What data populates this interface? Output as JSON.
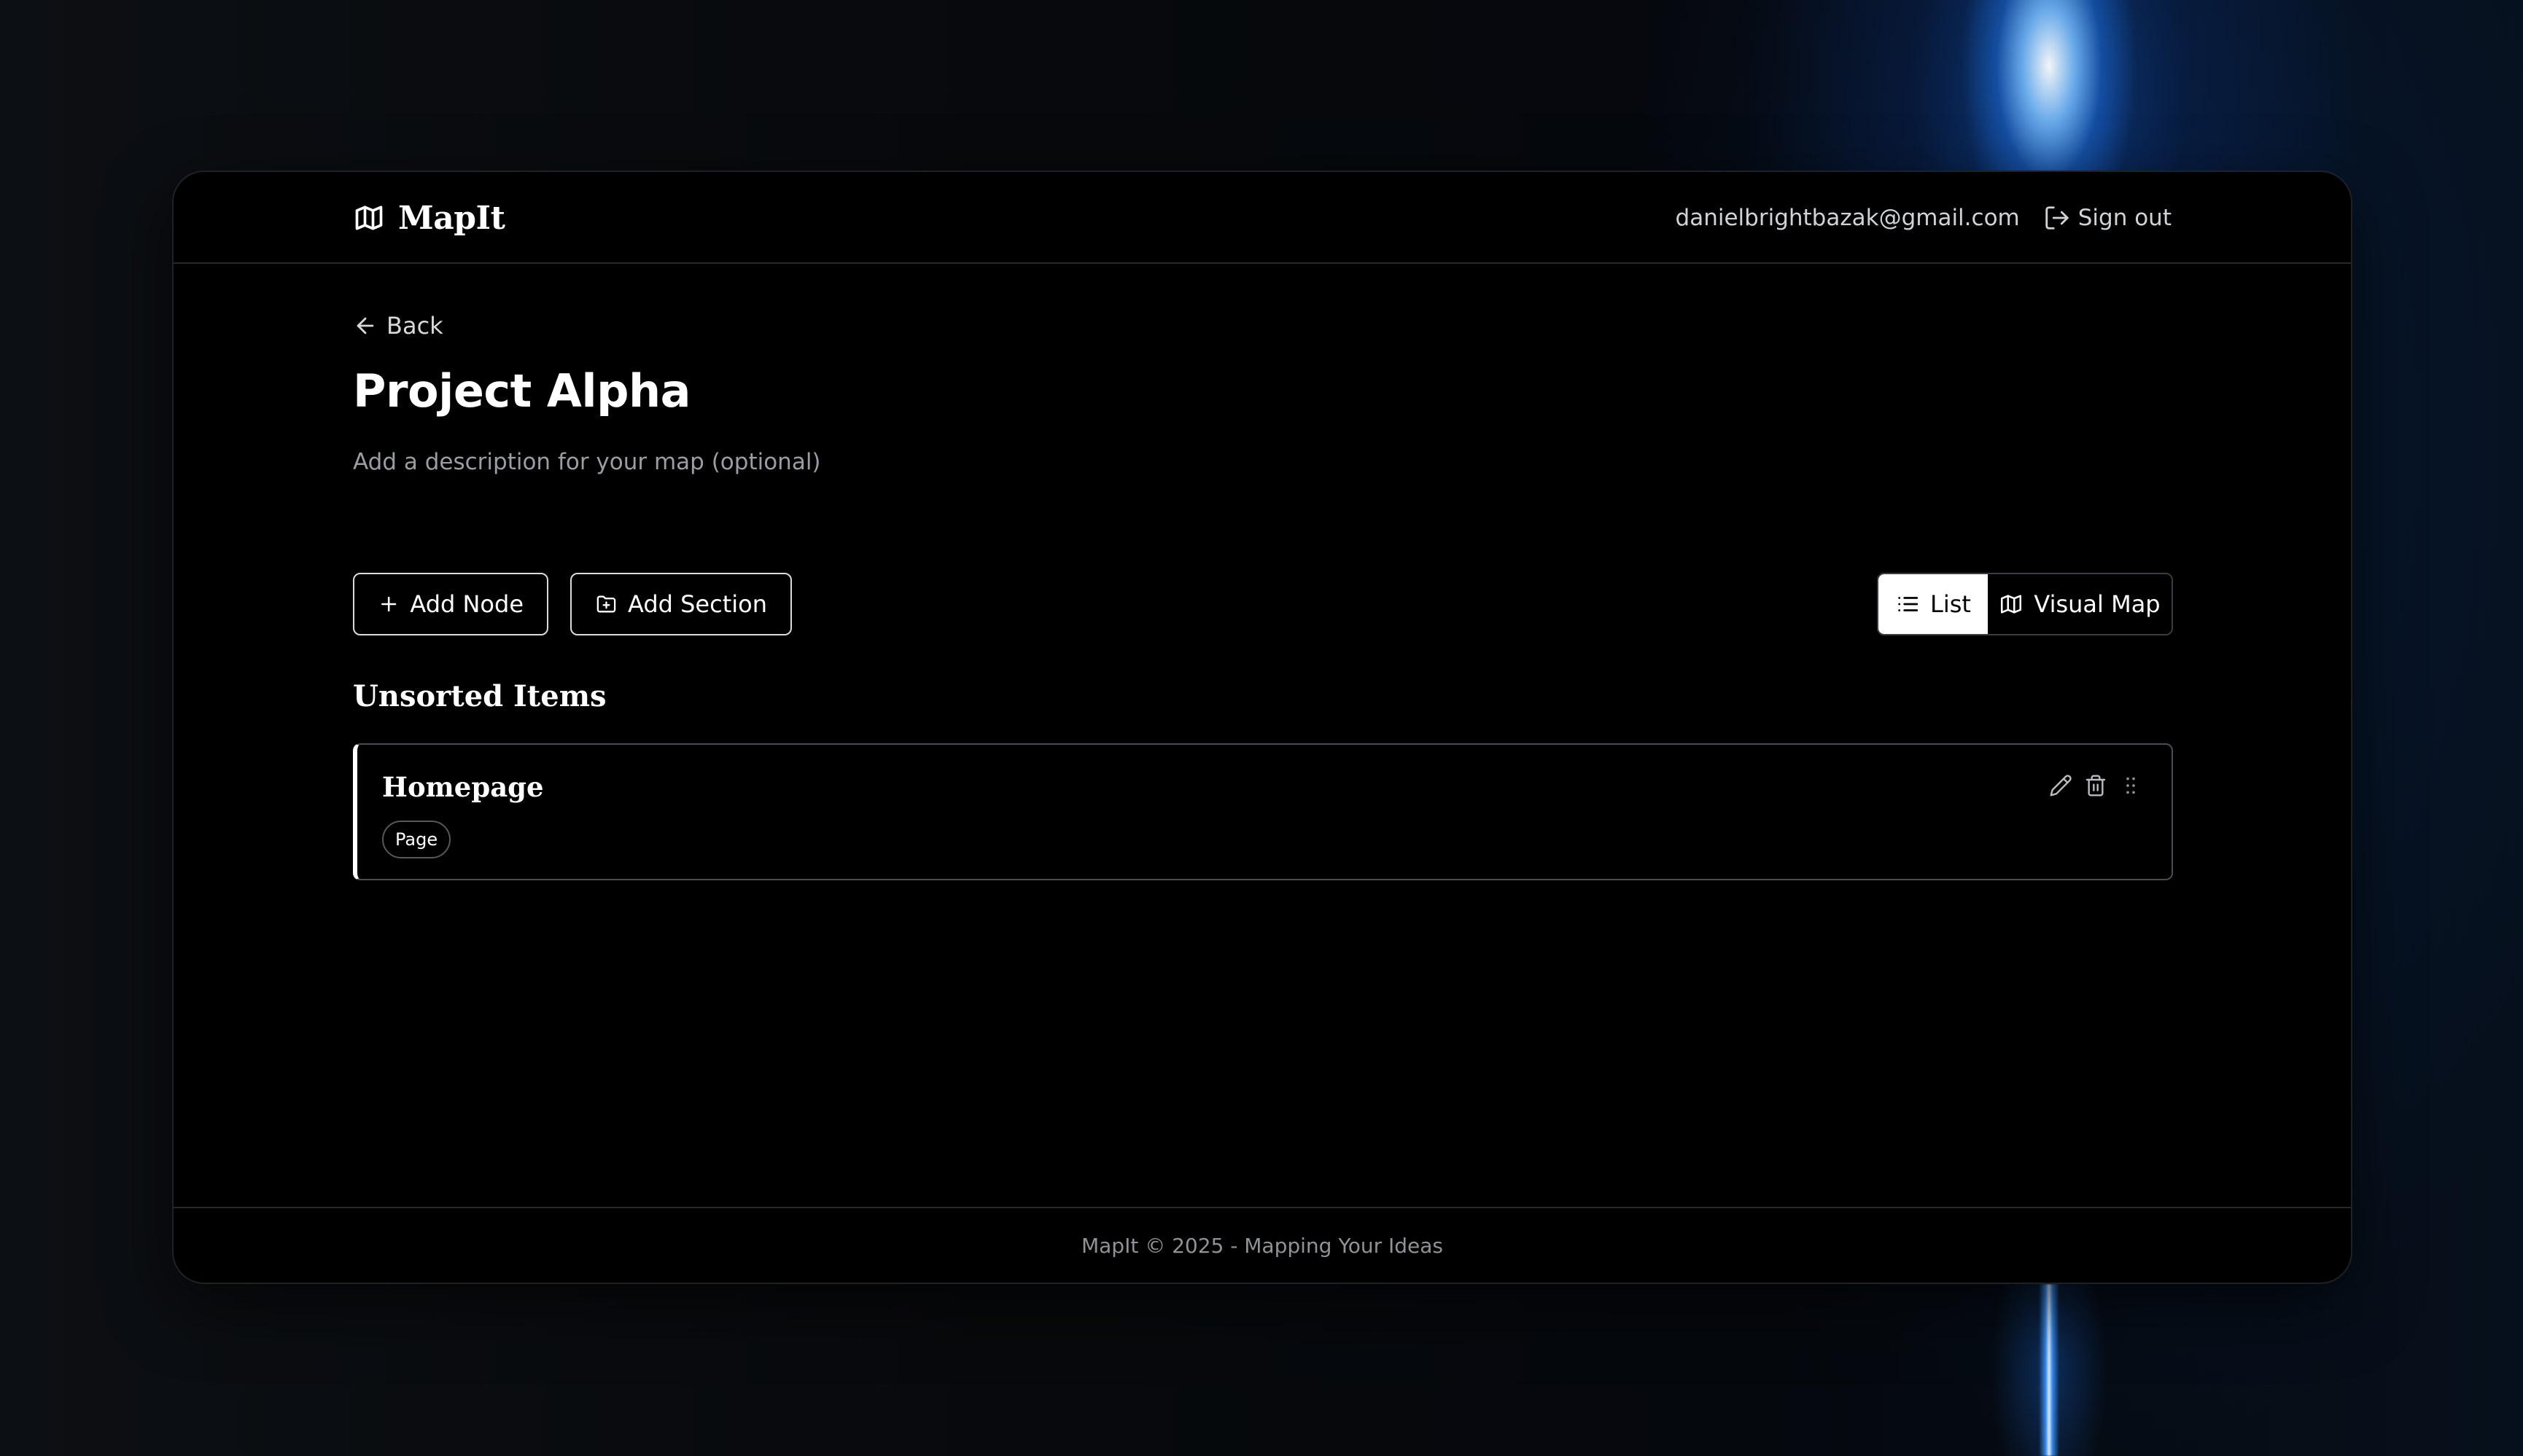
{
  "app": {
    "name": "MapIt",
    "logo_icon": "map-icon"
  },
  "header": {
    "user_email": "danielbrightbazak@gmail.com",
    "signout_label": "Sign out",
    "signout_icon": "log-out-icon"
  },
  "nav": {
    "back_label": "Back",
    "back_icon": "arrow-left-icon"
  },
  "project": {
    "title": "Project Alpha",
    "description_placeholder": "Add a description for your map (optional)"
  },
  "toolbar": {
    "add_node_label": "Add Node",
    "add_node_icon": "plus-icon",
    "add_section_label": "Add Section",
    "add_section_icon": "folder-plus-icon"
  },
  "view_toggle": {
    "active": "List",
    "options": [
      {
        "label": "List",
        "icon": "list-icon"
      },
      {
        "label": "Visual Map",
        "icon": "map-icon"
      }
    ]
  },
  "sections": [
    {
      "heading": "Unsorted Items",
      "nodes": [
        {
          "title": "Homepage",
          "badge": "Page",
          "actions": [
            "edit-icon",
            "trash-icon",
            "drag-handle-icon"
          ]
        }
      ]
    }
  ],
  "footer": {
    "text": "MapIt © 2025 - Mapping Your Ideas"
  },
  "colors": {
    "background": "#000000",
    "accent_glow": "#3a8cff",
    "border": "#26292e",
    "text_muted": "#9a9da3"
  }
}
